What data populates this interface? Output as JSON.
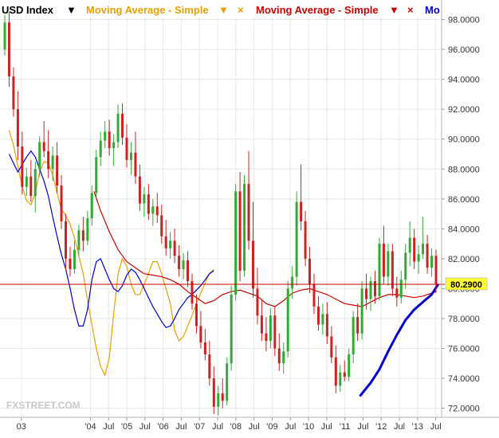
{
  "legend": {
    "symbol": "USD Index",
    "symbol_arrow": "▼",
    "ma1_label": "Moving Average - Simple",
    "ma1_arrow": "▼",
    "ma1_close": "×",
    "ma2_label": "Moving Average - Simple",
    "ma2_arrow": "▼",
    "ma2_close": "×",
    "ma3_label": "Mo",
    "colors": {
      "symbol": "#000000",
      "ma1": "#e8a000",
      "ma2": "#cc0000",
      "ma3": "#0000cc"
    }
  },
  "watermark": "FXSTREET.COM",
  "chart_data": {
    "type": "candlestick",
    "ylim": [
      71.5,
      99.2
    ],
    "y_ticks": [
      "98.0000",
      "96.0000",
      "94.0000",
      "92.0000",
      "90.0000",
      "88.0000",
      "86.0000",
      "84.0000",
      "82.0000",
      "80.0000",
      "78.0000",
      "76.0000",
      "74.0000",
      "72.0000"
    ],
    "y_tick_values": [
      98,
      96,
      94,
      92,
      90,
      88,
      86,
      84,
      82,
      80,
      78,
      76,
      74,
      72
    ],
    "x_labels": [
      {
        "label": "03",
        "x": 0.5
      },
      {
        "label": "'04",
        "x": 2.4
      },
      {
        "label": "Jul",
        "x": 2.9
      },
      {
        "label": "'05",
        "x": 3.4
      },
      {
        "label": "Jul",
        "x": 3.9
      },
      {
        "label": "'06",
        "x": 4.4
      },
      {
        "label": "Jul",
        "x": 4.9
      },
      {
        "label": "'07",
        "x": 5.4
      },
      {
        "label": "Jul",
        "x": 5.9
      },
      {
        "label": "'08",
        "x": 6.4
      },
      {
        "label": "Jul",
        "x": 6.9
      },
      {
        "label": "'09",
        "x": 7.4
      },
      {
        "label": "Jul",
        "x": 7.9
      },
      {
        "label": "'10",
        "x": 8.4
      },
      {
        "label": "Jul",
        "x": 8.9
      },
      {
        "label": "'11",
        "x": 9.4
      },
      {
        "label": "Jul",
        "x": 9.9
      },
      {
        "label": "'12",
        "x": 10.4
      },
      {
        "label": "Jul",
        "x": 10.9
      },
      {
        "label": "'13",
        "x": 11.4
      },
      {
        "label": "Jul",
        "x": 11.9
      }
    ],
    "last_price": 80.29,
    "last_price_label": "80.2900",
    "current_price_line_color": "#cc0000",
    "price_label_bg": "#ffff33",
    "candle_up_color": "#33aa33",
    "candle_down_color": "#cc2222",
    "candles": [
      [
        96.0,
        98.3,
        95.6,
        97.8
      ],
      [
        97.8,
        98.5,
        93.5,
        94.2
      ],
      [
        94.2,
        94.8,
        91.5,
        92.0
      ],
      [
        92.0,
        93.2,
        88.6,
        89.5
      ],
      [
        89.5,
        90.5,
        86.3,
        86.8
      ],
      [
        86.8,
        88.1,
        86.2,
        87.5
      ],
      [
        87.5,
        88.6,
        85.8,
        86.2
      ],
      [
        86.2,
        88.5,
        85.1,
        88.0
      ],
      [
        88.0,
        90.2,
        87.5,
        89.8
      ],
      [
        89.8,
        91.2,
        88.8,
        89.2
      ],
      [
        89.2,
        90.6,
        87.4,
        88.0
      ],
      [
        88.0,
        89.5,
        87.2,
        88.9
      ],
      [
        88.9,
        89.8,
        86.4,
        86.9
      ],
      [
        86.9,
        87.6,
        84.0,
        84.5
      ],
      [
        84.5,
        85.0,
        81.2,
        82.0
      ],
      [
        82.0,
        82.8,
        80.8,
        81.3
      ],
      [
        81.3,
        83.2,
        81.0,
        82.6
      ],
      [
        82.6,
        84.3,
        82.2,
        83.9
      ],
      [
        83.9,
        84.8,
        82.5,
        83.2
      ],
      [
        83.2,
        85.2,
        82.9,
        84.7
      ],
      [
        84.7,
        86.9,
        84.2,
        86.4
      ],
      [
        86.4,
        89.3,
        86.1,
        88.8
      ],
      [
        88.8,
        90.5,
        88.2,
        89.9
      ],
      [
        89.9,
        91.2,
        89.4,
        90.5
      ],
      [
        90.5,
        91.3,
        88.9,
        89.4
      ],
      [
        89.4,
        90.3,
        88.2,
        89.8
      ],
      [
        89.8,
        92.3,
        89.4,
        91.7
      ],
      [
        91.7,
        92.4,
        89.6,
        90.1
      ],
      [
        90.1,
        91.0,
        88.1,
        88.6
      ],
      [
        88.6,
        89.8,
        87.6,
        89.1
      ],
      [
        89.1,
        90.5,
        87.0,
        87.5
      ],
      [
        87.5,
        88.3,
        85.2,
        85.7
      ],
      [
        85.7,
        86.8,
        84.8,
        86.3
      ],
      [
        86.3,
        87.0,
        84.6,
        85.0
      ],
      [
        85.0,
        86.0,
        84.2,
        85.5
      ],
      [
        85.5,
        86.4,
        84.4,
        84.9
      ],
      [
        84.9,
        85.6,
        83.0,
        83.5
      ],
      [
        83.5,
        84.6,
        82.2,
        82.7
      ],
      [
        82.7,
        83.8,
        82.0,
        83.2
      ],
      [
        83.2,
        84.0,
        81.7,
        82.2
      ],
      [
        82.2,
        82.9,
        80.8,
        81.3
      ],
      [
        81.3,
        82.4,
        80.6,
        81.9
      ],
      [
        81.9,
        82.5,
        80.1,
        80.5
      ],
      [
        80.5,
        81.0,
        78.6,
        79.0
      ],
      [
        79.0,
        79.6,
        77.0,
        77.5
      ],
      [
        77.5,
        78.5,
        76.0,
        76.4
      ],
      [
        76.4,
        77.3,
        75.2,
        75.6
      ],
      [
        75.6,
        76.5,
        73.5,
        74.0
      ],
      [
        74.0,
        74.8,
        71.6,
        72.1
      ],
      [
        72.1,
        73.5,
        71.5,
        73.0
      ],
      [
        73.0,
        74.0,
        72.0,
        72.5
      ],
      [
        72.5,
        75.4,
        72.2,
        75.0
      ],
      [
        75.0,
        80.2,
        74.5,
        79.6
      ],
      [
        79.6,
        87.0,
        79.2,
        86.5
      ],
      [
        86.5,
        87.8,
        80.5,
        81.2
      ],
      [
        81.2,
        87.6,
        80.8,
        87.0
      ],
      [
        87.0,
        89.2,
        82.6,
        83.2
      ],
      [
        83.2,
        85.8,
        79.4,
        80.0
      ],
      [
        80.0,
        81.4,
        77.6,
        78.2
      ],
      [
        78.2,
        79.3,
        76.5,
        77.0
      ],
      [
        77.0,
        78.1,
        75.8,
        76.5
      ],
      [
        76.5,
        78.7,
        76.0,
        78.2
      ],
      [
        78.2,
        78.8,
        75.5,
        76.0
      ],
      [
        76.0,
        77.0,
        74.5,
        75.0
      ],
      [
        75.0,
        76.4,
        74.3,
        75.8
      ],
      [
        75.8,
        80.5,
        75.4,
        80.0
      ],
      [
        80.0,
        81.5,
        79.3,
        80.8
      ],
      [
        80.8,
        86.5,
        80.2,
        85.8
      ],
      [
        85.8,
        88.3,
        83.9,
        84.5
      ],
      [
        84.5,
        85.2,
        81.5,
        82.0
      ],
      [
        82.0,
        82.8,
        79.7,
        80.3
      ],
      [
        80.3,
        81.0,
        78.3,
        78.8
      ],
      [
        78.8,
        79.5,
        77.2,
        77.6
      ],
      [
        77.6,
        79.0,
        76.9,
        78.3
      ],
      [
        78.3,
        79.1,
        76.3,
        76.8
      ],
      [
        76.8,
        77.5,
        75.0,
        75.4
      ],
      [
        75.4,
        76.2,
        73.0,
        73.5
      ],
      [
        73.5,
        74.9,
        73.1,
        74.4
      ],
      [
        74.4,
        75.2,
        73.8,
        74.1
      ],
      [
        74.1,
        76.0,
        73.8,
        75.6
      ],
      [
        75.6,
        78.5,
        75.0,
        78.1
      ],
      [
        78.1,
        79.0,
        76.5,
        77.0
      ],
      [
        77.0,
        80.5,
        76.6,
        80.0
      ],
      [
        80.0,
        81.0,
        78.6,
        79.3
      ],
      [
        79.3,
        80.8,
        78.5,
        80.5
      ],
      [
        80.5,
        81.2,
        79.0,
        79.5
      ],
      [
        79.5,
        83.4,
        79.2,
        83.0
      ],
      [
        83.0,
        84.2,
        80.3,
        80.8
      ],
      [
        80.8,
        83.0,
        80.2,
        82.5
      ],
      [
        82.5,
        83.0,
        79.5,
        80.0
      ],
      [
        80.0,
        80.8,
        78.8,
        79.4
      ],
      [
        79.4,
        81.2,
        79.0,
        80.6
      ],
      [
        80.6,
        83.0,
        80.0,
        82.4
      ],
      [
        82.4,
        84.5,
        81.5,
        83.4
      ],
      [
        83.4,
        84.0,
        81.3,
        81.8
      ],
      [
        81.8,
        82.9,
        81.0,
        82.3
      ],
      [
        82.3,
        84.8,
        82.0,
        83.0
      ],
      [
        83.0,
        83.6,
        81.0,
        81.4
      ],
      [
        81.4,
        82.7,
        80.8,
        82.2
      ],
      [
        82.2,
        82.6,
        79.7,
        80.29
      ]
    ],
    "series": [
      {
        "color": "#e8a000",
        "points": [
          [
            1,
            90.6
          ],
          [
            2,
            89.6
          ],
          [
            3,
            88.2
          ],
          [
            4,
            86.8
          ],
          [
            5,
            85.9
          ],
          [
            6,
            85.6
          ],
          [
            7,
            86.4
          ],
          [
            8,
            87.8
          ],
          [
            9,
            88.5
          ],
          [
            10,
            88.4
          ],
          [
            11,
            87.6
          ],
          [
            12,
            86.4
          ],
          [
            13,
            85.3
          ],
          [
            14,
            84.9
          ],
          [
            15,
            84.3
          ],
          [
            16,
            83.4
          ],
          [
            17,
            82.2
          ],
          [
            18,
            81.0
          ],
          [
            19,
            79.2
          ],
          [
            20,
            77.6
          ],
          [
            21,
            76.0
          ],
          [
            22,
            74.8
          ],
          [
            23,
            74.2
          ],
          [
            24,
            75.4
          ],
          [
            25,
            78.3
          ],
          [
            26,
            81.0
          ],
          [
            27,
            82.0
          ],
          [
            28,
            81.5
          ],
          [
            29,
            80.3
          ],
          [
            30,
            79.6
          ],
          [
            31,
            79.6
          ],
          [
            32,
            80.3
          ],
          [
            33,
            81.0
          ],
          [
            34,
            81.8
          ],
          [
            35,
            81.8
          ],
          [
            36,
            81.0
          ],
          [
            37,
            80.0
          ],
          [
            38,
            79.0
          ],
          [
            39,
            77.2
          ],
          [
            40,
            76.5
          ],
          [
            41,
            76.8
          ],
          [
            42,
            77.5
          ],
          [
            43,
            78.2
          ],
          [
            44,
            79.0
          ],
          [
            45,
            79.7
          ],
          [
            46,
            80.4
          ],
          [
            47,
            81.0
          ],
          [
            48,
            81.3
          ]
        ]
      },
      {
        "color": "#cc0000",
        "points": [
          [
            20.5,
            86.5
          ],
          [
            22,
            85.2
          ],
          [
            24,
            83.8
          ],
          [
            26,
            82.6
          ],
          [
            28,
            81.8
          ],
          [
            30,
            81.4
          ],
          [
            32,
            81.0
          ],
          [
            34,
            80.9
          ],
          [
            36,
            80.8
          ],
          [
            38,
            80.6
          ],
          [
            40,
            80.3
          ],
          [
            42,
            79.8
          ],
          [
            44,
            79.4
          ],
          [
            46,
            79.0
          ],
          [
            48,
            79.2
          ],
          [
            50,
            79.6
          ],
          [
            52,
            79.8
          ],
          [
            54,
            79.9
          ],
          [
            56,
            79.7
          ],
          [
            58,
            79.5
          ],
          [
            60,
            79.0
          ],
          [
            62,
            78.8
          ],
          [
            64,
            79.2
          ],
          [
            66,
            79.7
          ],
          [
            68,
            79.9
          ],
          [
            70,
            80.0
          ],
          [
            72,
            79.8
          ],
          [
            74,
            79.6
          ],
          [
            76,
            79.3
          ],
          [
            78,
            79.0
          ],
          [
            80,
            78.9
          ],
          [
            82,
            78.8
          ],
          [
            84,
            79.1
          ],
          [
            86,
            79.4
          ],
          [
            88,
            79.6
          ],
          [
            90,
            79.6
          ],
          [
            92,
            79.5
          ],
          [
            94,
            79.4
          ],
          [
            96,
            79.5
          ],
          [
            98,
            79.7
          ],
          [
            99,
            79.8
          ]
        ]
      },
      {
        "color": "#0000cc",
        "points": [
          [
            1,
            89.0
          ],
          [
            2,
            88.4
          ],
          [
            3,
            87.8
          ],
          [
            4,
            88.3
          ],
          [
            5,
            88.8
          ],
          [
            6,
            89.2
          ],
          [
            7,
            88.8
          ],
          [
            8,
            88.0
          ],
          [
            9,
            87.2
          ],
          [
            10,
            86.2
          ],
          [
            11,
            84.8
          ],
          [
            12,
            83.5
          ],
          [
            13,
            82.3
          ],
          [
            14,
            81.3
          ],
          [
            15,
            80.0
          ],
          [
            16,
            78.6
          ],
          [
            17,
            77.5
          ],
          [
            18,
            77.5
          ],
          [
            19,
            78.6
          ],
          [
            20,
            80.6
          ],
          [
            21,
            81.8
          ],
          [
            22,
            82.0
          ],
          [
            23,
            81.3
          ],
          [
            24,
            80.6
          ],
          [
            25,
            80.0
          ],
          [
            26,
            79.8
          ],
          [
            27,
            80.2
          ],
          [
            28,
            80.9
          ],
          [
            29,
            81.3
          ],
          [
            30,
            81.1
          ],
          [
            31,
            80.6
          ],
          [
            32,
            80.0
          ],
          [
            33,
            79.4
          ],
          [
            34,
            78.8
          ],
          [
            35,
            78.3
          ],
          [
            36,
            77.8
          ],
          [
            37,
            77.4
          ],
          [
            38,
            77.5
          ],
          [
            39,
            78.0
          ],
          [
            40,
            78.6
          ],
          [
            41,
            79.0
          ],
          [
            42,
            79.4
          ],
          [
            43,
            79.6
          ],
          [
            44,
            79.9
          ],
          [
            45,
            80.2
          ],
          [
            46,
            80.6
          ],
          [
            47,
            81.0
          ],
          [
            48,
            81.2
          ]
        ]
      },
      {
        "color": "#0000cc",
        "points": [
          [
            81.5,
            72.8
          ],
          [
            84,
            73.7
          ],
          [
            86,
            74.6
          ],
          [
            88,
            75.8
          ],
          [
            90,
            76.9
          ],
          [
            92,
            77.9
          ],
          [
            94,
            78.6
          ],
          [
            96,
            79.1
          ],
          [
            98,
            79.6
          ],
          [
            99.5,
            80.3
          ]
        ]
      }
    ]
  }
}
